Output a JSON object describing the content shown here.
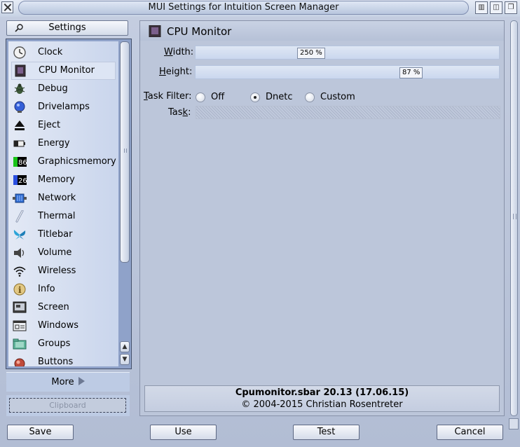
{
  "window": {
    "title": "MUI Settings for Intuition Screen Manager"
  },
  "sidebar": {
    "settings_label": "Settings",
    "items": [
      {
        "label": "Clock",
        "icon": "clock-icon"
      },
      {
        "label": "CPU Monitor",
        "icon": "cpu-monitor-icon",
        "selected": true
      },
      {
        "label": "Debug",
        "icon": "bug-icon"
      },
      {
        "label": "Drivelamps",
        "icon": "drivelamp-icon"
      },
      {
        "label": "Eject",
        "icon": "eject-icon"
      },
      {
        "label": "Energy",
        "icon": "battery-icon"
      },
      {
        "label": "Graphicsmemory",
        "icon": "graphics-memory-icon",
        "badge": "86"
      },
      {
        "label": "Memory",
        "icon": "memory-icon",
        "badge": "26"
      },
      {
        "label": "Network",
        "icon": "network-icon"
      },
      {
        "label": "Thermal",
        "icon": "thermometer-icon"
      },
      {
        "label": "Titlebar",
        "icon": "butterfly-icon"
      },
      {
        "label": "Volume",
        "icon": "speaker-icon"
      },
      {
        "label": "Wireless",
        "icon": "wireless-icon"
      },
      {
        "label": "Info",
        "icon": "info-icon"
      },
      {
        "label": "Screen",
        "icon": "screen-icon"
      },
      {
        "label": "Windows",
        "icon": "windows-icon"
      },
      {
        "label": "Groups",
        "icon": "folder-icon"
      },
      {
        "label": "Buttons",
        "icon": "buttons-icon"
      }
    ],
    "more_label": "More",
    "clipboard_label": "Clipboard"
  },
  "panel": {
    "title": "CPU Monitor",
    "width": {
      "label": "Width:",
      "value": "250 %",
      "fraction": 0.38
    },
    "height": {
      "label": "Height:",
      "value": "87 %",
      "fraction": 0.71
    },
    "task_filter": {
      "label": "Task Filter:",
      "options": [
        "Off",
        "Dnetc",
        "Custom"
      ],
      "selected": "Dnetc"
    },
    "task": {
      "label": "Task:",
      "value": ""
    },
    "info": {
      "line1": "Cpumonitor.sbar 20.13 (17.06.15)",
      "line2": "© 2004-2015 Christian Rosentreter"
    }
  },
  "buttons": {
    "save": "Save",
    "use": "Use",
    "test": "Test",
    "cancel": "Cancel"
  },
  "colors": {
    "window_bg": "#b8c2d8",
    "list_bg": "#d6dff0",
    "slider_bg": "#d4def1"
  }
}
